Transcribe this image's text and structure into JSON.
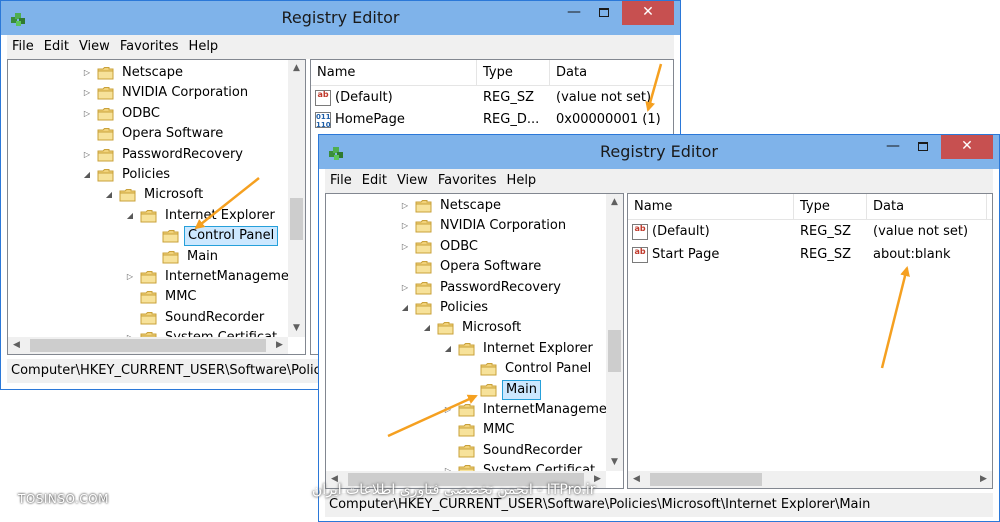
{
  "window_back": {
    "title": "Registry Editor",
    "menu": [
      "File",
      "Edit",
      "View",
      "Favorites",
      "Help"
    ],
    "tree": [
      "Netscape",
      "NVIDIA Corporation",
      "ODBC",
      "Opera Software",
      "PasswordRecovery",
      "Policies",
      "Microsoft",
      "Internet Explorer",
      "Control Panel",
      "Main",
      "InternetManagemer",
      "MMC",
      "SoundRecorder",
      "System Certificat"
    ],
    "selected": "Control Panel",
    "columns": [
      "Name",
      "Type",
      "Data"
    ],
    "values": [
      {
        "name": "(Default)",
        "type": "REG_SZ",
        "data": "(value not set)",
        "icon": "string-value-icon"
      },
      {
        "name": "HomePage",
        "type": "REG_D...",
        "data": "0x00000001 (1)",
        "icon": "binary-value-icon"
      }
    ],
    "status": "Computer\\HKEY_CURRENT_USER\\Software\\Policies\\Microsoft\\Internet Explorer\\Control Panel"
  },
  "window_front": {
    "title": "Registry Editor",
    "menu": [
      "File",
      "Edit",
      "View",
      "Favorites",
      "Help"
    ],
    "tree": [
      "Netscape",
      "NVIDIA Corporation",
      "ODBC",
      "Opera Software",
      "PasswordRecovery",
      "Policies",
      "Microsoft",
      "Internet Explorer",
      "Control Panel",
      "Main",
      "InternetManagemer",
      "MMC",
      "SoundRecorder",
      "System Certificat"
    ],
    "selected": "Main",
    "columns": [
      "Name",
      "Type",
      "Data"
    ],
    "values": [
      {
        "name": "(Default)",
        "type": "REG_SZ",
        "data": "(value not set)",
        "icon": "string-value-icon"
      },
      {
        "name": "Start Page",
        "type": "REG_SZ",
        "data": "about:blank",
        "icon": "string-value-icon"
      }
    ],
    "status": "Computer\\HKEY_CURRENT_USER\\Software\\Policies\\Microsoft\\Internet Explorer\\Main"
  },
  "watermarks": {
    "left": "TOSINSO.COM",
    "center": "ITPro.ir - انجمن تخصصی فناوری اطلاعات ایران"
  },
  "colors": {
    "titlebar": "#7fb3ea",
    "selection": "#cce8ff",
    "annotation_arrow": "#f5a020",
    "close_button": "#c75050"
  }
}
